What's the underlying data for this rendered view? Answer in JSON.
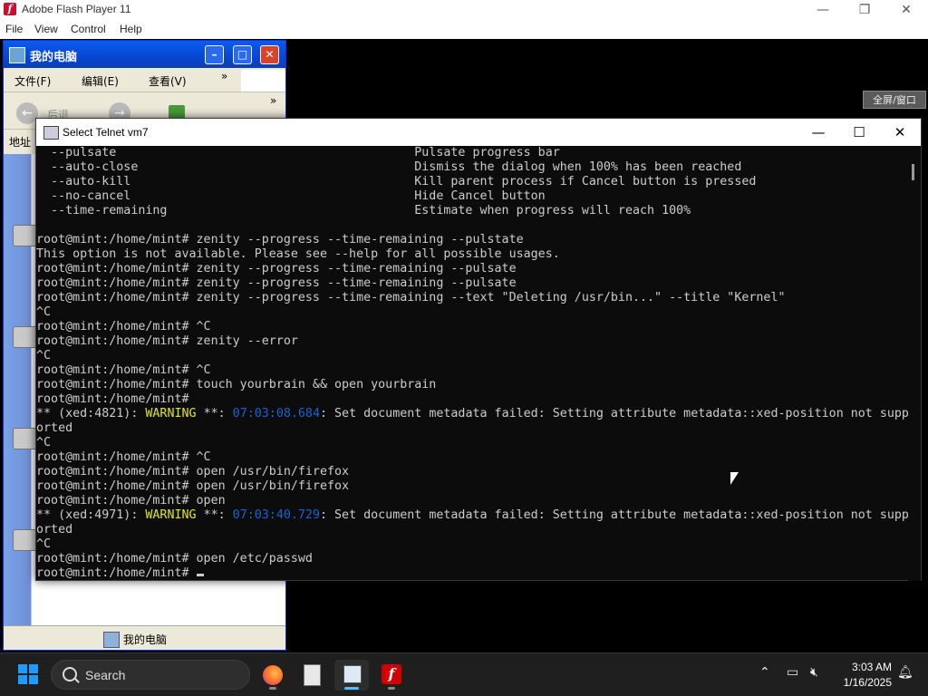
{
  "flash": {
    "title": "Adobe Flash Player 11",
    "menu": [
      "File",
      "View",
      "Control",
      "Help"
    ],
    "fullscreen_label": "全屏/窗口"
  },
  "explorer": {
    "title": "我的电脑",
    "menu": [
      "文件(F)",
      "编辑(E)",
      "查看(V)"
    ],
    "menu_more": "»",
    "toolbar": {
      "back_label": "后退",
      "more": "»"
    },
    "address_label": "地址",
    "status_text": "我的电脑"
  },
  "telnet": {
    "title": "Select Telnet vm7",
    "options": [
      {
        "flag": "--pulsate",
        "desc": "Pulsate progress bar"
      },
      {
        "flag": "--auto-close",
        "desc": "Dismiss the dialog when 100% has been reached"
      },
      {
        "flag": "--auto-kill",
        "desc": "Kill parent process if Cancel button is pressed"
      },
      {
        "flag": "--no-cancel",
        "desc": "Hide Cancel button"
      },
      {
        "flag": "--time-remaining",
        "desc": "Estimate when progress will reach 100%"
      }
    ],
    "prompt": "root@mint:/home/mint#",
    "lines": [
      "root@mint:/home/mint# zenity --progress --time-remaining --pulstate",
      "This option is not available. Please see --help for all possible usages.",
      "root@mint:/home/mint# zenity --progress --time-remaining --pulsate",
      "root@mint:/home/mint# zenity --progress --time-remaining --pulsate",
      "root@mint:/home/mint# zenity --progress --time-remaining --text \"Deleting /usr/bin...\" --title \"Kernel\"",
      "^C",
      "root@mint:/home/mint# ^C",
      "root@mint:/home/mint# zenity --error",
      "^C",
      "root@mint:/home/mint# ^C",
      "root@mint:/home/mint# touch yourbrain && open yourbrain",
      "root@mint:/home/mint#"
    ],
    "warning1": {
      "prefix": "** (xed:4821): ",
      "level": "WARNING",
      "mid": " **: ",
      "time": "07:03:08.684",
      "msg": ": Set document metadata failed: Setting attribute metadata::xed-position not supp",
      "wrap": "orted"
    },
    "lines2": [
      "^C",
      "root@mint:/home/mint# ^C",
      "root@mint:/home/mint# open /usr/bin/firefox",
      "root@mint:/home/mint# open /usr/bin/firefox",
      "root@mint:/home/mint# open"
    ],
    "warning2": {
      "prefix": "** (xed:4971): ",
      "level": "WARNING",
      "mid": " **: ",
      "time": "07:03:40.729",
      "msg": ": Set document metadata failed: Setting attribute metadata::xed-position not supp",
      "wrap": "orted"
    },
    "lines3": [
      "^C",
      "root@mint:/home/mint# open /etc/passwd"
    ],
    "last_prompt": "root@mint:/home/mint# "
  },
  "taskbar": {
    "search_label": "Search",
    "time": "3:03 AM",
    "date": "1/16/2025"
  },
  "colors": {
    "accent": "#4cc2ff",
    "warning": "#e5e510",
    "timestamp": "#1a63d0",
    "xp_title": "#0846d2"
  }
}
